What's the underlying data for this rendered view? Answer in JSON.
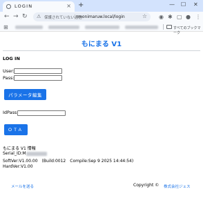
{
  "browser": {
    "tab_title": "LOGIN",
    "tab_close": "×",
    "new_tab": "+",
    "insecure_label": "保護されていない通信",
    "url": "monimaruw.local/login",
    "all_bookmarks": "すべてのブックマーク",
    "icons": [
      "globe-icon",
      "back-icon",
      "forward-icon",
      "reload-icon",
      "warning-icon",
      "star-icon",
      "apps-icon",
      "folder-icon"
    ]
  },
  "page": {
    "title": "もにまる V1",
    "login_heading": "LOG IN",
    "user_label": "User:",
    "pass_label": "Pass:",
    "param_button": "パラメータ編集",
    "idpass_label": "IdPass:",
    "ota_button": "OTA",
    "info_heading": "もにまる V1 情報",
    "serial_label": "Serial_ID:M",
    "softver": "SoftVer:V1.00.00　(Build:0012　Compile:Sep 9 2025 14:44:54)",
    "hardver": "HardVer:V1.00",
    "mail_link": "メールを送る",
    "copyright": "Copyright ©",
    "company": "株式会社ジェス"
  },
  "colors": {
    "accent": "#1a73e8",
    "chrome": "#d3e3fd"
  }
}
